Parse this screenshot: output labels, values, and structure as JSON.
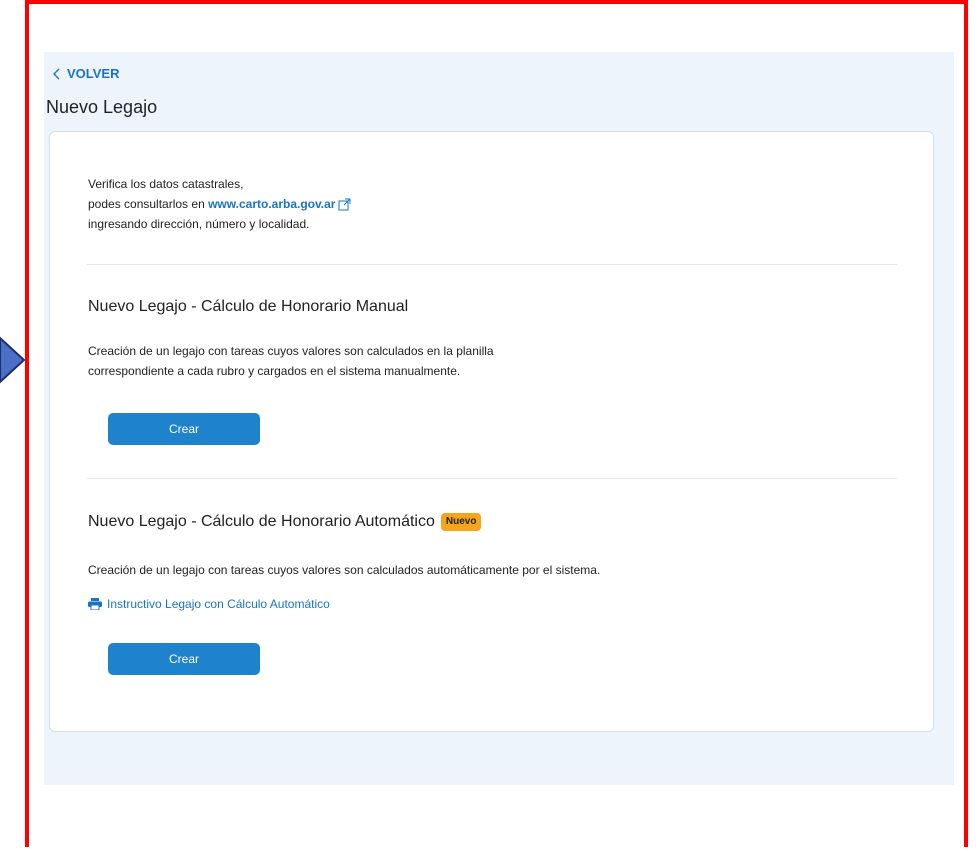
{
  "header": {
    "back_label": "VOLVER",
    "title": "Nuevo Legajo"
  },
  "intro": {
    "line1": "Verifica los datos catastrales,",
    "line2_prefix": "podes consultarlos en ",
    "link_text": "www.carto.arba.gov.ar",
    "line3": "ingresando dirección, número y localidad."
  },
  "manual": {
    "title": "Nuevo Legajo - Cálculo de Honorario Manual",
    "desc_line1": "Creación de un legajo con tareas cuyos valores son calculados en la planilla",
    "desc_line2": "correspondiente a cada rubro y cargados en el sistema manualmente.",
    "button_label": "Crear"
  },
  "automatic": {
    "title": "Nuevo Legajo - Cálculo de Honorario Automático",
    "badge": "Nuevo",
    "desc": "Creación de un legajo con tareas cuyos valores son calculados automáticamente por el sistema.",
    "instructivo_label": "Instructivo Legajo con Cálculo Automático",
    "button_label": "Crear"
  },
  "colors": {
    "accent": "#1f82cc",
    "link": "#1a73c8",
    "badge": "#f4a51c",
    "frame": "#ff0000",
    "page_background": "#eef4fc"
  }
}
